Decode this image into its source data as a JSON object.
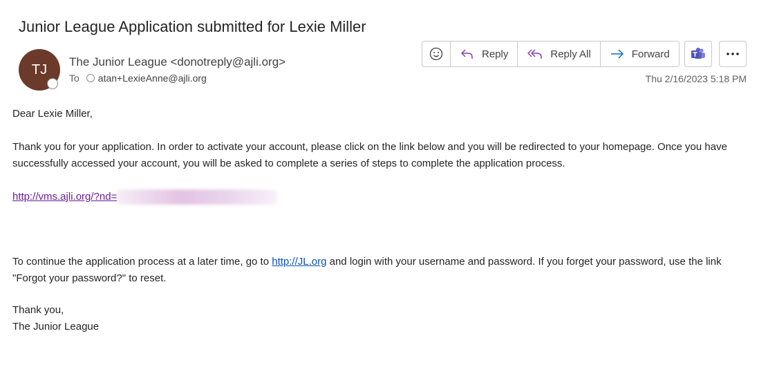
{
  "email": {
    "subject": "Junior League Application submitted for Lexie Miller",
    "avatar_initials": "TJ",
    "sender": "The Junior League <donotreply@ajli.org>",
    "to_label": "To",
    "recipient": "atan+LexieAnne@ajli.org",
    "timestamp": "Thu 2/16/2023 5:18 PM"
  },
  "actions": {
    "reply": "Reply",
    "reply_all": "Reply All",
    "forward": "Forward"
  },
  "body": {
    "greeting": "Dear Lexie Miller,",
    "para1": "Thank you for your application. In order to activate your account, please click on the link below and you will be redirected to your homepage. Once you have successfully accessed your account, you will be asked to complete a series of steps to complete the application process.",
    "activation_link": "http://vms.ajli.org/?nd=",
    "para2_before": "To continue the application process at a later time, go to ",
    "jl_link": "http://JL.org",
    "para2_after": " and login with your username and password.  If you forget your password, use the link \"Forgot your password?\" to reset.",
    "closing": "Thank you,",
    "signature": "The Junior League"
  },
  "colors": {
    "avatar_bg": "#6b3a2a",
    "visited_link": "#6a1b9a",
    "link": "#0b4fb3",
    "teams_purple": "#5b5fc7",
    "reply_icon": "#8a3bb0",
    "forward_icon": "#0f6cbd"
  }
}
